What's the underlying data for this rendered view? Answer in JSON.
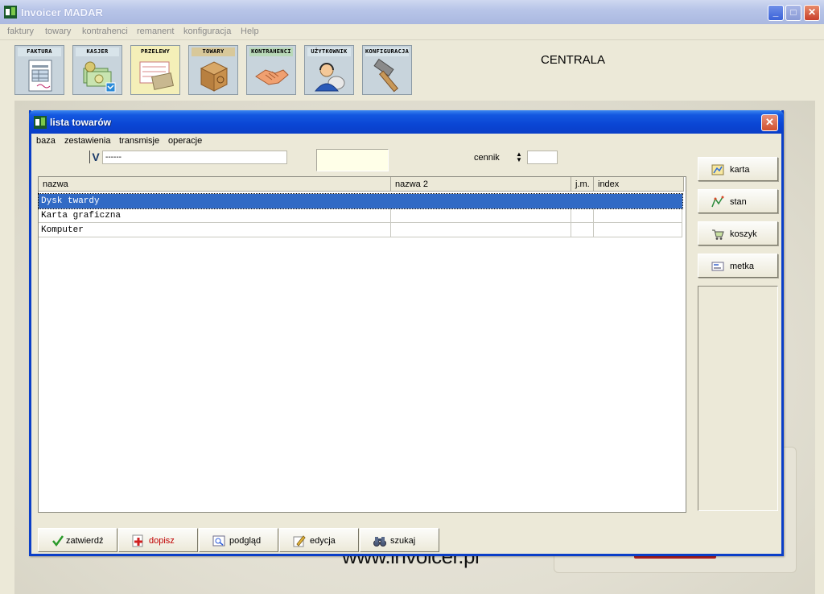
{
  "app": {
    "title": "Invoicer MADAR",
    "menu": [
      "faktury",
      "towary",
      "kontrahenci",
      "remanent",
      "konfiguracja",
      "Help"
    ]
  },
  "toolbar": {
    "tiles": [
      {
        "label": "FAKTURA",
        "icon": "invoice-document-icon",
        "color": "#d8e4ea"
      },
      {
        "label": "KASJER",
        "icon": "cash-money-icon",
        "color": "#d8e4ea"
      },
      {
        "label": "PRZELEWY",
        "icon": "bank-transfer-icon",
        "color": "#f4efb8"
      },
      {
        "label": "TOWARY",
        "icon": "cardboard-box-icon",
        "color": "#d8e4ea"
      },
      {
        "label": "KONTRAHENCI",
        "icon": "handshake-icon",
        "color": "#d8e4ea"
      },
      {
        "label": "UŻYTKOWNIK",
        "icon": "user-headset-icon",
        "color": "#d8e4ea"
      },
      {
        "label": "KONFIGURACJA",
        "icon": "hammer-icon",
        "color": "#d8e4ea"
      }
    ],
    "location": "CENTRALA"
  },
  "background": {
    "watermark": "www.invoicer.pl"
  },
  "dialog": {
    "title": "lista towarów",
    "menu": [
      "baza",
      "zestawienia",
      "transmisje",
      "operacje"
    ],
    "filter": {
      "check_mark": "V",
      "value": "------",
      "price_label": "cennik",
      "price_value": ""
    },
    "columns": [
      "nazwa",
      "nazwa 2",
      "j.m.",
      "index"
    ],
    "rows": [
      {
        "nazwa": "Dysk twardy",
        "nazwa2": "",
        "jm": "",
        "index": "",
        "selected": true
      },
      {
        "nazwa": "Karta graficzna",
        "nazwa2": "",
        "jm": "",
        "index": "",
        "selected": false
      },
      {
        "nazwa": "Komputer",
        "nazwa2": "",
        "jm": "",
        "index": "",
        "selected": false
      }
    ],
    "side_buttons": {
      "karta": "karta",
      "stan": "stan",
      "koszyk": "koszyk",
      "metka": "metka"
    },
    "bottom_buttons": {
      "zatwierdz": "zatwierdź",
      "dopisz": "dopisz",
      "podglad": "podgląd",
      "edycja": "edycja",
      "szukaj": "szukaj"
    }
  },
  "colors": {
    "selection": "#316ac5",
    "dialog_title": "#0a46d4",
    "dopisz_text": "#c00000"
  }
}
